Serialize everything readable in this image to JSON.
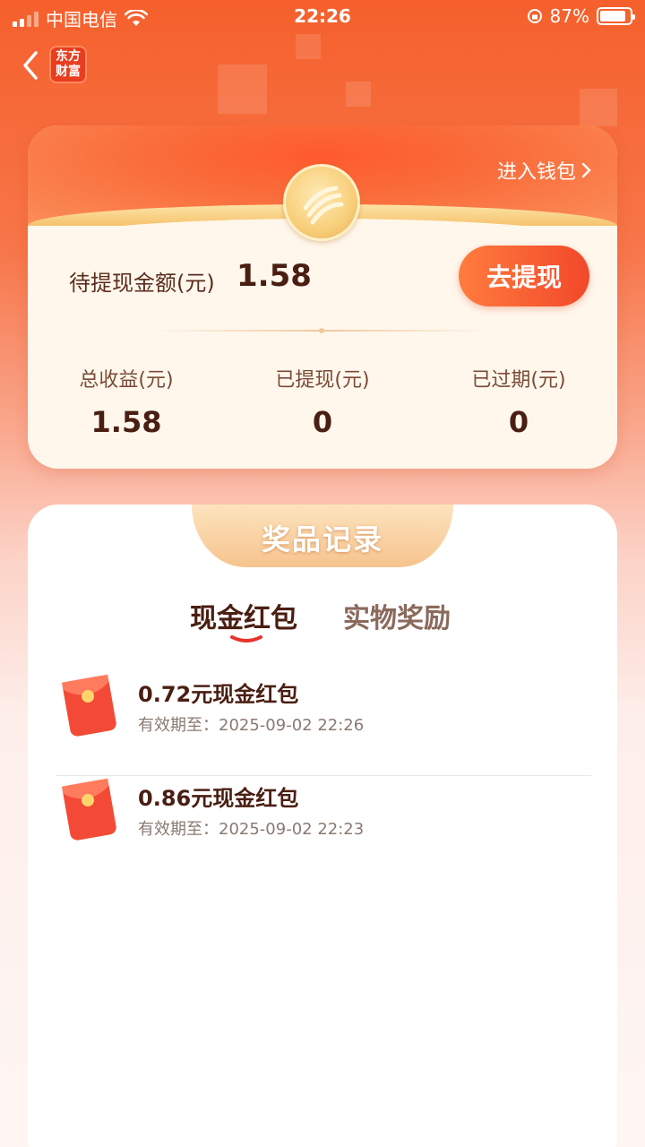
{
  "status_bar": {
    "carrier": "中国电信",
    "time": "22:26",
    "battery": "87%",
    "battery_level": 0.87
  },
  "nav": {
    "logo_line1": "东方",
    "logo_line2": "财富"
  },
  "wallet": {
    "enter_wallet": "进入钱包",
    "pending_label": "待提现金额(元)",
    "pending_value": "1.58",
    "withdraw_button": "去提现",
    "stats": [
      {
        "label": "总收益(元)",
        "value": "1.58"
      },
      {
        "label": "已提现(元)",
        "value": "0"
      },
      {
        "label": "已过期(元)",
        "value": "0"
      }
    ]
  },
  "records": {
    "title": "奖品记录",
    "tabs": [
      {
        "label": "现金红包",
        "active": true
      },
      {
        "label": "实物奖励",
        "active": false
      }
    ],
    "items": [
      {
        "title": "0.72元现金红包",
        "expiry": "有效期至：2025-09-02 22:26"
      },
      {
        "title": "0.86元现金红包",
        "expiry": "有效期至：2025-09-02 22:23"
      }
    ]
  },
  "colors": {
    "brand": "#f5602c",
    "button": "#f2482a",
    "text_dark": "#4a1e12"
  }
}
